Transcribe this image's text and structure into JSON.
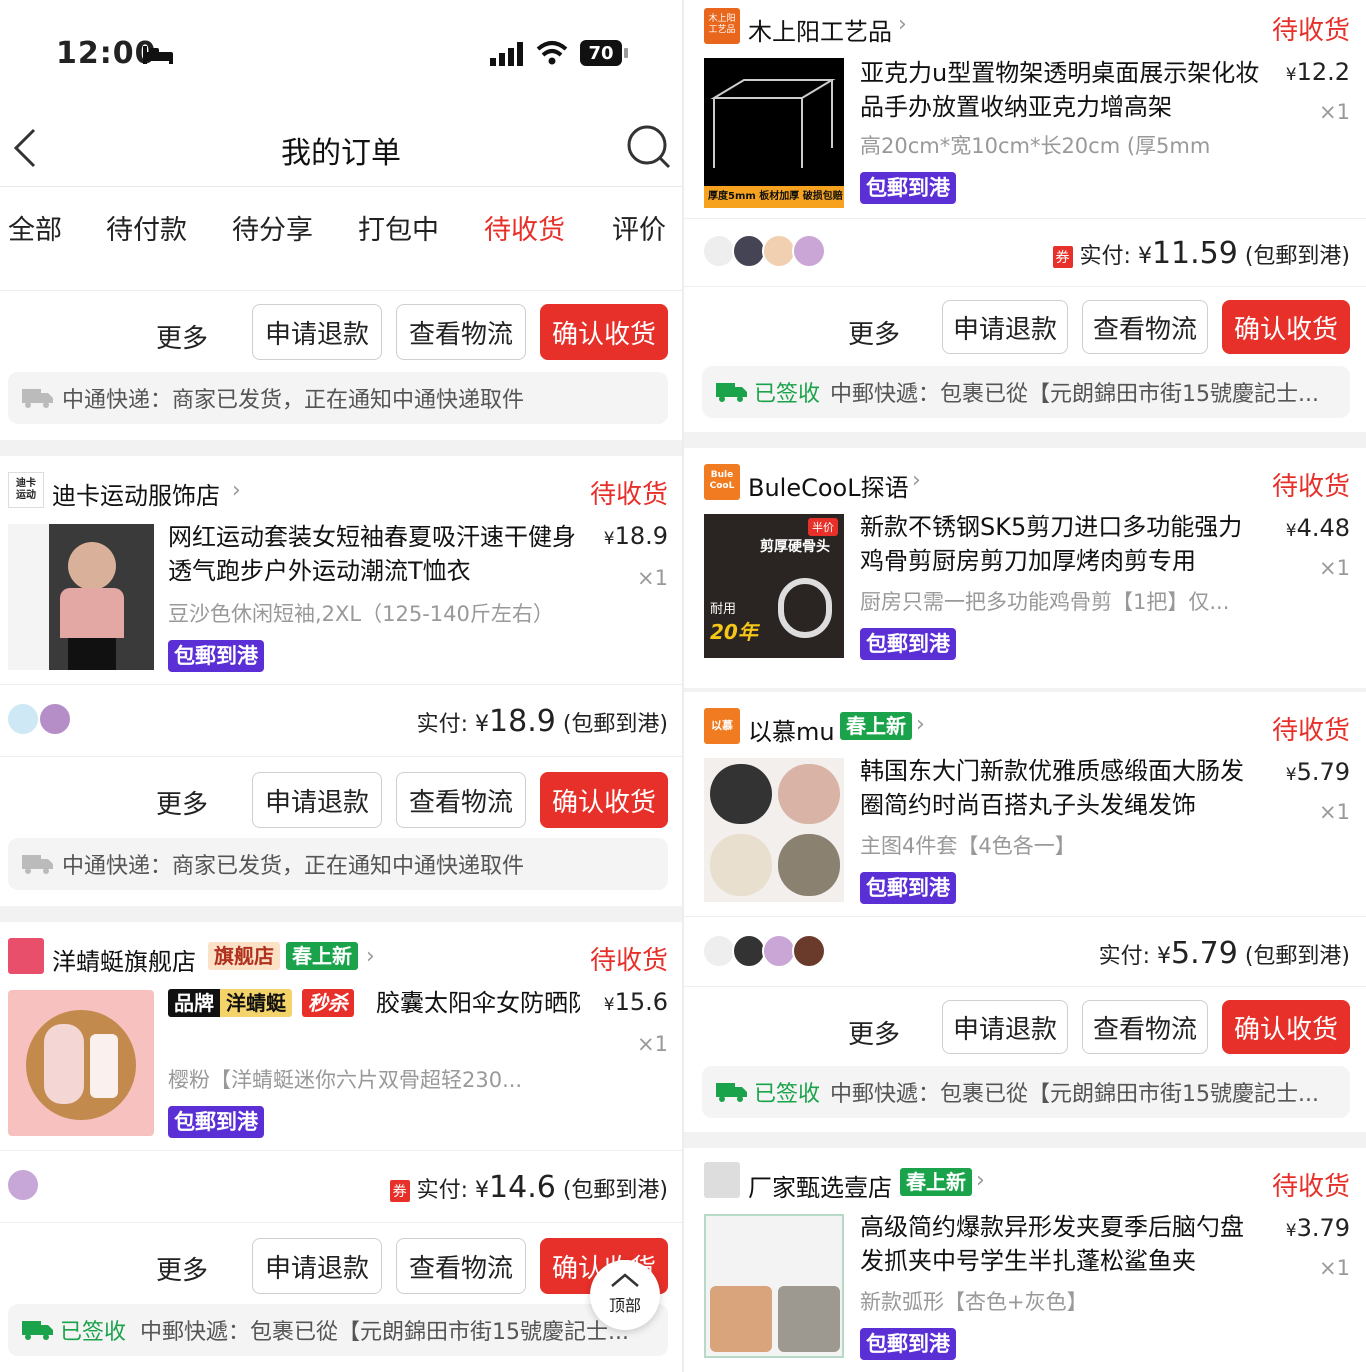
{
  "status_bar": {
    "time": "12:00",
    "battery": "70"
  },
  "header": {
    "title": "我的订单"
  },
  "tabs": [
    "全部",
    "待付款",
    "待分享",
    "打包中",
    "待收货",
    "评价"
  ],
  "active_tab": 4,
  "common": {
    "more": "更多",
    "refund": "申请退款",
    "logistics": "查看物流",
    "confirm": "确认收货",
    "status": "待收货",
    "post_tag": "包郵到港",
    "paid_label": "实付: ",
    "currency": "¥",
    "paid_suffix": " (包郵到港)",
    "signed": "已签收",
    "top": "顶部",
    "coupon": "券"
  },
  "left": {
    "partial": {
      "logistics": "中通快递：商家已发货，正在通知中通快递取件"
    },
    "orders": [
      {
        "shop": "迪卡运动服饰店",
        "shop_logo": "迪卡\n运动",
        "title": "网红运动套装女短袖春夏吸汗速干健身透气跑步户外运动潮流T恤衣",
        "spec": "豆沙色休闲短袖,2XL（125-140斤左右）",
        "price": "18.9",
        "qty": "×1",
        "paid": "18.9",
        "logistics": "中通快递：商家已发货，正在通知中通快递取件"
      },
      {
        "shop": "洋蜻蜓旗舰店",
        "badge1": "旗舰店",
        "badge2": "春上新",
        "brand_tag": "品牌",
        "brand_name": "洋蜻蜓",
        "flash": "秒杀",
        "title": "胶囊太阳伞女防晒防紫外线遮阳晴雨伞两用迷你五折…",
        "spec": "樱粉【洋蜻蜓迷你六片双骨超轻230...",
        "price": "15.6",
        "qty": "×1",
        "paid": "14.6",
        "logistics": "中郵快遞：包裹已從【元朗錦田市街15號慶記士..."
      }
    ]
  },
  "right": {
    "orders": [
      {
        "shop": "木上阳工艺品",
        "title": "亚克力u型置物架透明桌面展示架化妆品手办放置收纳亚克力增高架",
        "spec": "高20cm*宽10cm*长20cm (厚5mm",
        "price": "12.2",
        "qty": "×1",
        "paid": "11.59",
        "img_caption": "厚度5mm  板材加厚 破损包赔",
        "logistics": "中郵快遞：包裹已從【元朗錦田市街15號慶記士..."
      },
      {
        "shop": "BuleCooL探语",
        "title": "新款不锈钢SK5剪刀进口多功能强力鸡骨剪厨房剪刀加厚烤肉剪专用",
        "spec": "厨房只需一把多功能鸡骨剪【1把】仅...",
        "price": "4.48",
        "qty": "×1",
        "img_text1": "剪厚硬骨头",
        "img_text2": "耐用",
        "img_text3": "20年",
        "img_badge": "半价"
      },
      {
        "shop": "以慕mu",
        "badge": "春上新",
        "title": "韩国东大门新款优雅质感缎面大肠发圈简约时尚百搭丸子头发绳发饰",
        "spec": "主图4件套【4色各一】",
        "price": "5.79",
        "qty": "×1",
        "paid": "5.79",
        "logistics": "中郵快遞：包裹已從【元朗錦田市街15號慶記士..."
      },
      {
        "shop": "厂家甄选壹店",
        "badge": "春上新",
        "title": "高级简约爆款异形发夹夏季后脑勺盘发抓夹中号学生半扎蓬松鲨鱼夹",
        "spec": "新款弧形【杏色+灰色】",
        "price": "3.79",
        "qty": "×1"
      }
    ]
  },
  "colors": {
    "accent": "#e8302a",
    "post": "#5b2fd6",
    "signed": "#1aa34a",
    "badge_new": "#1aa34a"
  },
  "icons": [
    "back-icon",
    "search-icon",
    "truck-icon",
    "chevron-right-icon",
    "coupon-icon",
    "up-arrow-icon"
  ]
}
